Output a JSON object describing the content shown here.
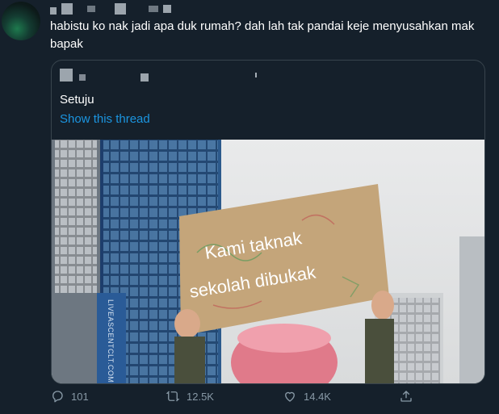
{
  "tweet": {
    "text": "habistu ko nak jadi apa duk rumah? dah lah tak pandai keje menyusahkan mak bapak"
  },
  "quote": {
    "text": "Setuju",
    "show_thread": "Show this thread",
    "image": {
      "sign_line1": "Kami taknak",
      "sign_line2": "sekolah dibukak",
      "building_sign": "LIVEASCENTCLT.COM"
    }
  },
  "actions": {
    "replies": "101",
    "retweets": "12.5K",
    "likes": "14.4K"
  },
  "colors": {
    "background": "#15202b",
    "link": "#1b95e0",
    "muted": "#8899a6",
    "border": "#38444d"
  }
}
